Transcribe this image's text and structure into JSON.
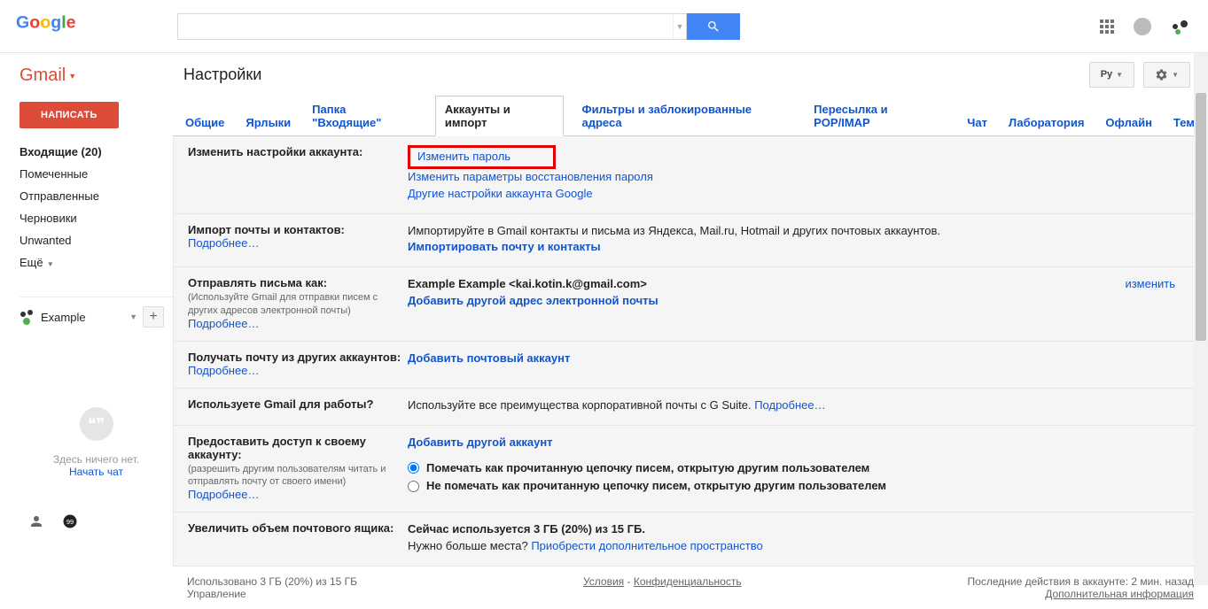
{
  "header": {
    "search_placeholder": ""
  },
  "gmail_label": "Gmail",
  "compose": "НАПИСАТЬ",
  "page_title": "Настройки",
  "lang_btn": "Ру",
  "sidebar": {
    "items": [
      {
        "label": "Входящие (20)",
        "bold": true
      },
      {
        "label": "Помеченные"
      },
      {
        "label": "Отправленные"
      },
      {
        "label": "Черновики"
      },
      {
        "label": "Unwanted"
      },
      {
        "label": "Ещё",
        "caret": true
      }
    ],
    "profile": "Example",
    "hang_empty": "Здесь ничего нет.",
    "hang_start": "Начать чат"
  },
  "tabs": [
    "Общие",
    "Ярлыки",
    "Папка \"Входящие\"",
    "Аккаунты и импорт",
    "Фильтры и заблокированные адреса",
    "Пересылка и POP/IMAP",
    "Чат",
    "Лаборатория",
    "Офлайн",
    "Темы"
  ],
  "active_tab": 3,
  "sections": {
    "s0": {
      "title": "Изменить настройки аккаунта:",
      "l1": "Изменить пароль",
      "l2": "Изменить параметры восстановления пароля",
      "l3": "Другие настройки аккаунта Google"
    },
    "s1": {
      "title": "Импорт почты и контактов:",
      "more": "Подробнее…",
      "text": "Импортируйте в Gmail контакты и письма из Яндекса, Mail.ru, Hotmail и других почтовых аккаунтов.",
      "action": "Импортировать почту и контакты"
    },
    "s2": {
      "title": "Отправлять письма как:",
      "sub": "(Используйте Gmail для отправки писем с других адресов электронной почты)",
      "more": "Подробнее…",
      "identity": "Example Example <kai.kotin.k@gmail.com>",
      "action": "Добавить другой адрес электронной почты",
      "edit": "изменить"
    },
    "s3": {
      "title": "Получать почту из других аккаунтов:",
      "more": "Подробнее…",
      "action": "Добавить почтовый аккаунт"
    },
    "s4": {
      "title": "Используете Gmail для работы?",
      "text": "Используйте все преимущества корпоративной почты с G Suite. ",
      "more": "Подробнее…"
    },
    "s5": {
      "title": "Предоставить доступ к своему аккаунту:",
      "sub": "(разрешить другим пользователям читать и отправлять почту от своего имени)",
      "more": "Подробнее…",
      "action": "Добавить другой аккаунт",
      "r1": "Помечать как прочитанную цепочку писем, открытую другим пользователем",
      "r2": "Не помечать как прочитанную цепочку писем, открытую другим пользователем"
    },
    "s6": {
      "title": "Увеличить объем почтового ящика:",
      "text1": "Сейчас используется 3 ГБ (20%) из 15 ГБ.",
      "text2": "Нужно больше места? ",
      "action": "Приобрести дополнительное пространство"
    }
  },
  "footer": {
    "left1": "Использовано 3 ГБ (20%) из 15 ГБ",
    "left2": "Управление",
    "c1": "Условия",
    "c2": "Конфиденциальность",
    "r1": "Последние действия в аккаунте: 2 мин. назад",
    "r2": "Дополнительная информация"
  }
}
